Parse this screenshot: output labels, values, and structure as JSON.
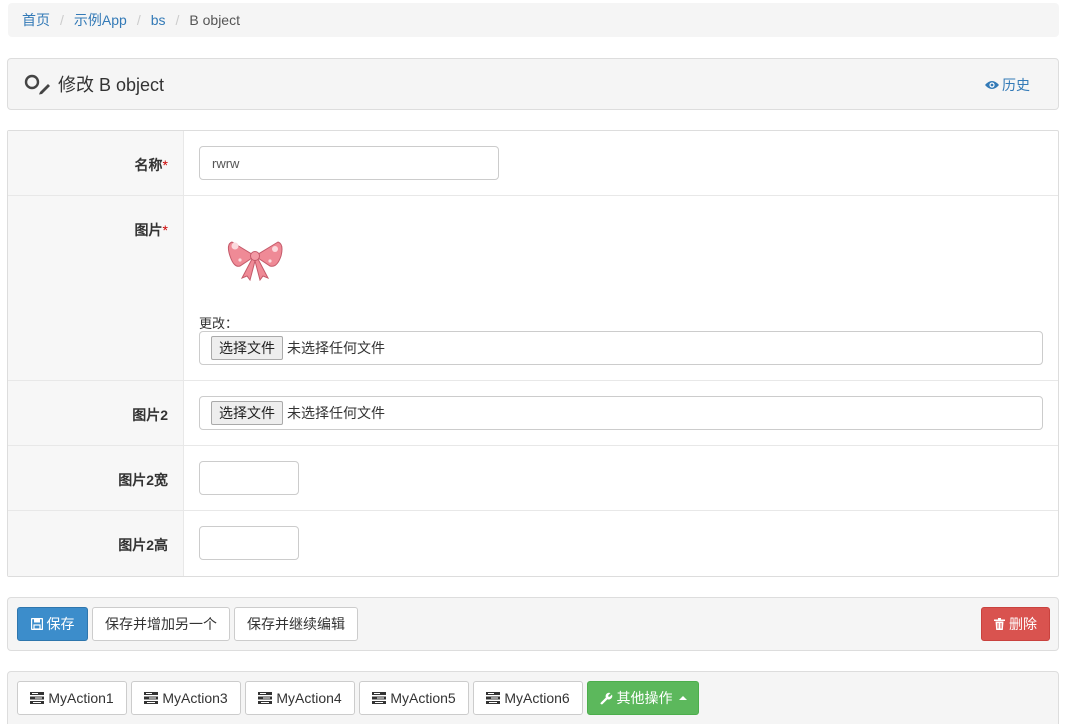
{
  "breadcrumb": {
    "items": [
      "首页",
      "示例App",
      "bs"
    ],
    "current": "B object",
    "separator": "/"
  },
  "header": {
    "title": "修改 B object",
    "history_label": "历史"
  },
  "form": {
    "name": {
      "label": "名称",
      "required_mark": "*",
      "value": "rwrw"
    },
    "image": {
      "label": "图片",
      "required_mark": "*",
      "change_label": "更改：",
      "file_button": "选择文件",
      "file_status": "未选择任何文件"
    },
    "image2": {
      "label": "图片2",
      "file_button": "选择文件",
      "file_status": "未选择任何文件"
    },
    "image2_width": {
      "label": "图片2宽",
      "value": ""
    },
    "image2_height": {
      "label": "图片2高",
      "value": ""
    }
  },
  "submit": {
    "save": "保存",
    "save_add_another": "保存并增加另一个",
    "save_continue": "保存并继续编辑",
    "delete": "删除"
  },
  "actions": {
    "items": [
      "MyAction1",
      "MyAction3",
      "MyAction4",
      "MyAction5",
      "MyAction6"
    ],
    "more": "其他操作"
  },
  "colors": {
    "link": "#337ab7",
    "primary": "#3c8dcb",
    "danger": "#d9534f",
    "success": "#5cb85c",
    "required": "#cc0000"
  }
}
